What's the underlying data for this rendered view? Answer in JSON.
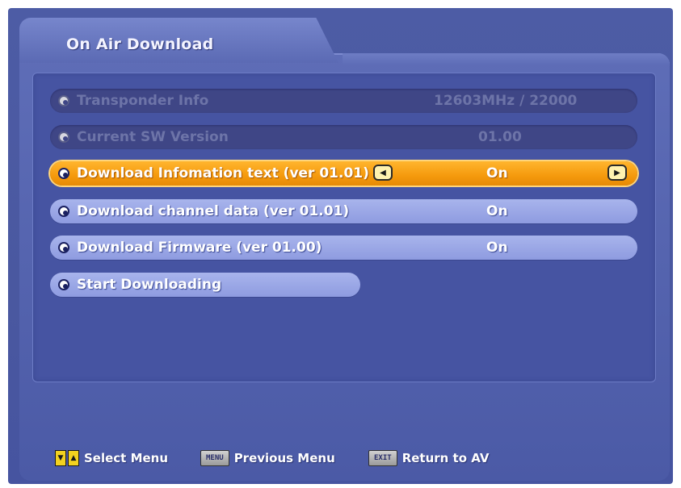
{
  "window": {
    "title": "On Air Download"
  },
  "menu": {
    "items": [
      {
        "label": "Transponder Info",
        "value": "12603MHz / 22000",
        "state": "disabled"
      },
      {
        "label": "Current SW Version",
        "value": "01.00",
        "state": "disabled"
      },
      {
        "label": "Download Infomation text (ver 01.01)",
        "value": "On",
        "state": "focused"
      },
      {
        "label": "Download channel data (ver 01.01)",
        "value": "On",
        "state": "normal"
      },
      {
        "label": "Download Firmware (ver 01.00)",
        "value": "On",
        "state": "normal"
      },
      {
        "label": "Start Downloading",
        "state": "normal"
      }
    ],
    "left_arrow_icon": "triangle-left-icon",
    "right_arrow_icon": "triangle-right-icon"
  },
  "footer": {
    "select": {
      "keys": [
        "▼",
        "▲"
      ],
      "label": "Select Menu"
    },
    "previous": {
      "key": "MENU",
      "label": "Previous Menu"
    },
    "exit": {
      "key": "EXIT",
      "label": "Return to AV"
    }
  },
  "colors": {
    "background": "#4d5ca5",
    "focus": "#f59a0d",
    "row_normal": "#a8b4ec",
    "row_disabled": "#3f4686"
  }
}
